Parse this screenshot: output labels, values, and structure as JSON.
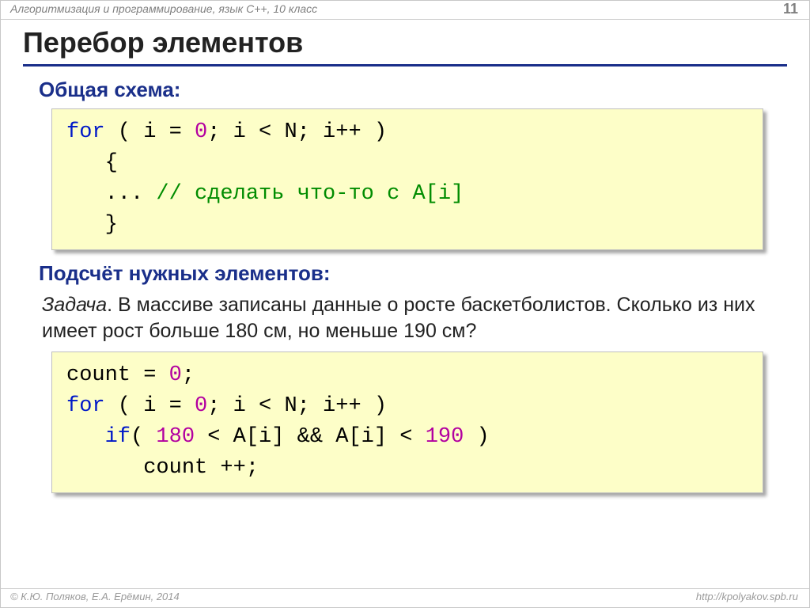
{
  "header": {
    "course": "Алгоритмизация и программирование, язык C++, 10 класс",
    "page": "11"
  },
  "title": "Перебор элементов",
  "section1": {
    "heading": "Общая схема:",
    "code": {
      "kw_for": "for",
      "open": " ( i",
      "eq": "=",
      "zero": "0",
      "mid": "; i",
      "lt": "<",
      "n": "N; i++ )",
      "brace_open": "   {",
      "ellipsis": "   ... ",
      "comment": "// сделать что-то c A[i]",
      "brace_close": "   }"
    }
  },
  "section2": {
    "heading": "Подсчёт нужных элементов:",
    "task_lead": "Задача",
    "task_body": ". В массиве записаны данные о росте баскетболистов. Сколько из них имеет рост больше 180 см, но меньше 190 см?",
    "code": {
      "count_init_a": "count",
      "count_init_b": "=",
      "count_init_c": "0",
      "count_init_d": ";",
      "kw_for": "for",
      "for_rest_a": " ( i",
      "for_rest_b": "=",
      "for_zero": "0",
      "for_rest_c": "; i",
      "for_rest_d": "<",
      "for_rest_e": "N; i++ )",
      "kw_if": "   if",
      "if_a": "( ",
      "n180": "180",
      "if_b": "<",
      "if_c": "A[i] && A[i]",
      "if_d": "<",
      "n190": "190",
      "if_e": " )",
      "body": "      count ++;"
    }
  },
  "footer": {
    "left": "© К.Ю. Поляков, Е.А. Ерёмин, 2014",
    "right": "http://kpolyakov.spb.ru"
  }
}
